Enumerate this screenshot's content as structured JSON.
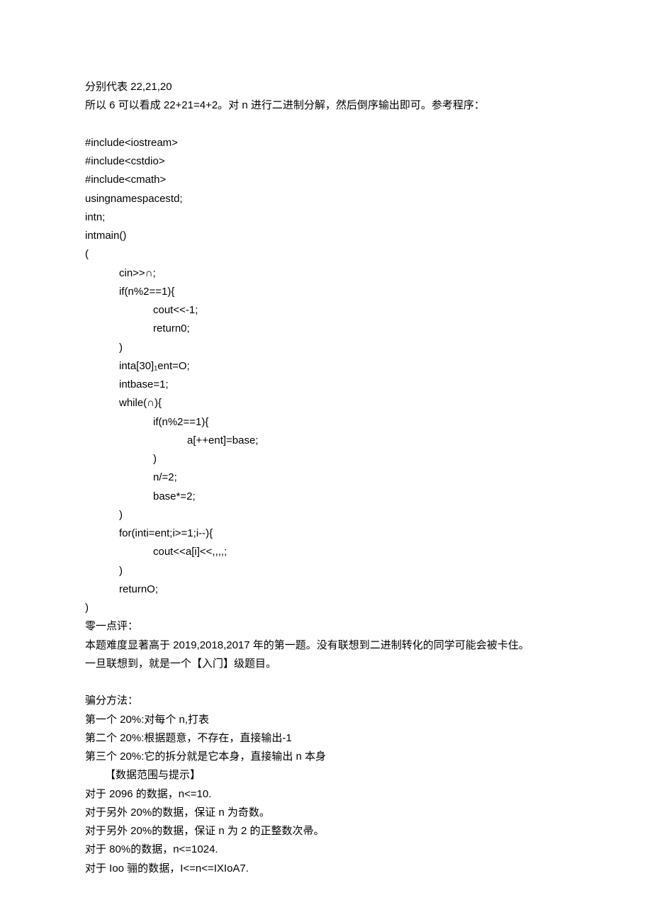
{
  "lines": [
    {
      "cls": "line",
      "text": "分别代表 22,21,20"
    },
    {
      "cls": "line",
      "text": "所以 6 可以看成 22+21=4+2。对 n 进行二进制分解，然后倒序输出即可。参考程序："
    },
    {
      "cls": "line",
      "text": " "
    },
    {
      "cls": "line",
      "text": "#include<iostream>"
    },
    {
      "cls": "line",
      "text": "#include<cstdio>"
    },
    {
      "cls": "line",
      "text": "#include<cmath>"
    },
    {
      "cls": "line",
      "text": "usingnamespacestd;"
    },
    {
      "cls": "line",
      "text": "intn;"
    },
    {
      "cls": "line",
      "text": "intmain()"
    },
    {
      "cls": "line",
      "text": "("
    },
    {
      "cls": "line indent1",
      "text": "cin>>∩;"
    },
    {
      "cls": "line indent1",
      "text": "if(n%2==1){"
    },
    {
      "cls": "line indent2",
      "text": "cout<<-1;"
    },
    {
      "cls": "line indent2",
      "text": "return0;"
    },
    {
      "cls": "line indent1",
      "text": ")"
    },
    {
      "cls": "line indent1",
      "text": "inta[30]₁ent=O;"
    },
    {
      "cls": "line indent1",
      "text": "intbase=1;"
    },
    {
      "cls": "line indent1",
      "text": "while(∩){"
    },
    {
      "cls": "line indent2",
      "text": "if(n%2==1){"
    },
    {
      "cls": "line indent3",
      "text": "a[++ent]=base;"
    },
    {
      "cls": "line indent2",
      "text": ")"
    },
    {
      "cls": "line indent2",
      "text": "n/=2;"
    },
    {
      "cls": "line indent2",
      "text": "base*=2;"
    },
    {
      "cls": "line indent1",
      "text": ")"
    },
    {
      "cls": "line indent1",
      "text": "for(inti=ent;i>=1;i--){"
    },
    {
      "cls": "line indent2",
      "text": "cout<<a[i]<<,,,,;"
    },
    {
      "cls": "line indent1",
      "text": ")"
    },
    {
      "cls": "line indent1",
      "text": "returnO;"
    },
    {
      "cls": "line",
      "text": ")"
    },
    {
      "cls": "line",
      "text": "零一点评："
    },
    {
      "cls": "line",
      "text": "本题难度显著高于 2019,2018,2017 年的第一题。没有联想到二进制转化的同学可能会被卡住。"
    },
    {
      "cls": "line",
      "text": "一旦联想到，就是一个【入门】级题目。"
    },
    {
      "cls": "line",
      "text": " "
    },
    {
      "cls": "line",
      "text": "骗分方法："
    },
    {
      "cls": "line",
      "text": "第一个 20%:对每个 n,打表"
    },
    {
      "cls": "line",
      "text": "第二个 20%:根据题意，不存在，直接输出-1"
    },
    {
      "cls": "line",
      "text": "第三个 20%:它的拆分就是它本身，直接输出 n 本身"
    },
    {
      "cls": "line section-indent",
      "text": "【数据范围与提示】"
    },
    {
      "cls": "line",
      "text": "对于 2096 的数据，n<=10."
    },
    {
      "cls": "line",
      "text": "对于另外 20%的数据，保证 n 为奇数。"
    },
    {
      "cls": "line",
      "text": "对于另外 20%的数据，保证 n 为 2 的正整数次帚。"
    },
    {
      "cls": "line",
      "text": "对于 80%的数据，n<=1024."
    },
    {
      "cls": "line",
      "text": "对于 Ioo 骊的数据，I<=n<=IXIoA7."
    }
  ]
}
